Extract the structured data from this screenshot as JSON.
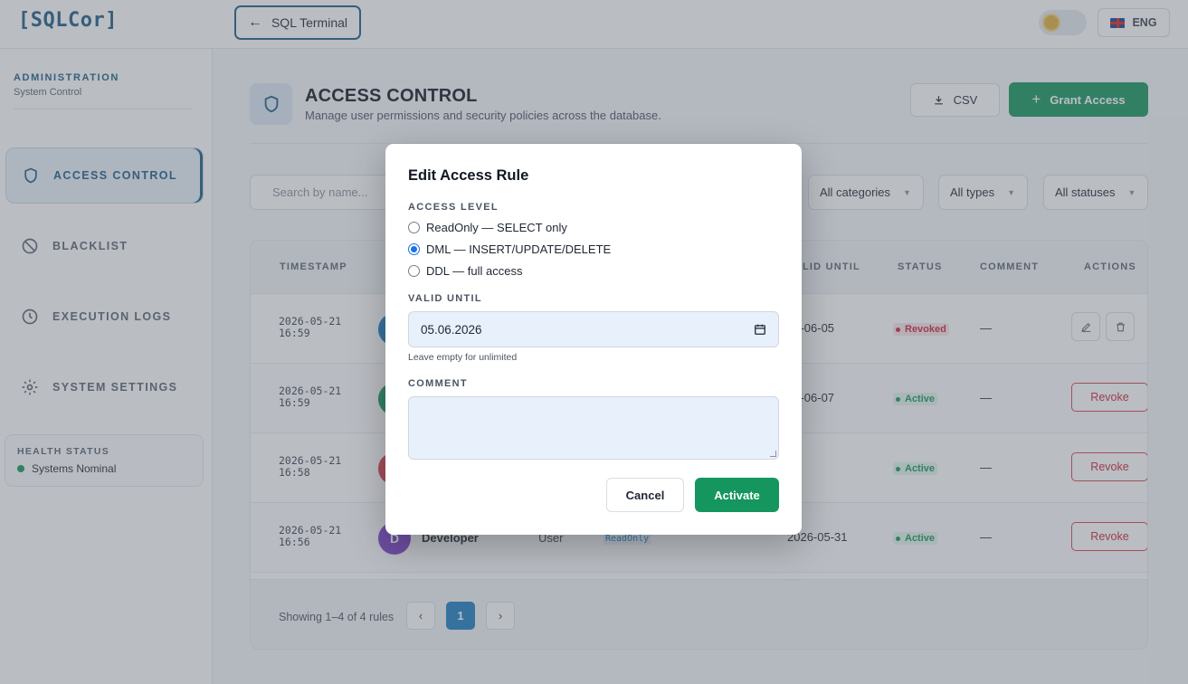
{
  "app": {
    "logo": "[SQLCor]"
  },
  "topbar": {
    "back_label": "SQL Terminal",
    "lang_label": "ENG"
  },
  "sidebar": {
    "section_title": "ADMINISTRATION",
    "section_subtitle": "System Control",
    "items": [
      {
        "label": "ACCESS CONTROL",
        "icon": "shield-icon",
        "active": true
      },
      {
        "label": "BLACKLIST",
        "icon": "ban-icon",
        "active": false
      },
      {
        "label": "EXECUTION LOGS",
        "icon": "clock-icon",
        "active": false
      },
      {
        "label": "SYSTEM SETTINGS",
        "icon": "gear-icon",
        "active": false
      }
    ],
    "health": {
      "title": "HEALTH STATUS",
      "value": "Systems Nominal",
      "color": "#15965e"
    }
  },
  "page": {
    "title": "ACCESS CONTROL",
    "subtitle": "Manage user permissions and security policies across the database.",
    "csv_label": "CSV",
    "grant_label": "Grant Access"
  },
  "filters": {
    "search_placeholder": "Search by name...",
    "categories": "All categories",
    "types": "All types",
    "statuses": "All statuses"
  },
  "table": {
    "columns": [
      "TIMESTAMP",
      "LID UNTIL",
      "STATUS",
      "COMMENT",
      "ACTIONS"
    ],
    "rows": [
      {
        "date": "2026-05-21",
        "time": "16:59",
        "avatar_color": "#1d7fbf",
        "until": "26-06-05",
        "status": "Revoked",
        "comment": "—",
        "actions": "icons"
      },
      {
        "date": "2026-05-21",
        "time": "16:59",
        "avatar_color": "#15965e",
        "until": "26-06-07",
        "status": "Active",
        "comment": "—",
        "actions": "Revoke"
      },
      {
        "date": "2026-05-21",
        "time": "16:58",
        "avatar_color": "#d9414f",
        "until": "",
        "status": "Active",
        "comment": "—",
        "actions": "Revoke"
      },
      {
        "date": "2026-05-21",
        "time": "16:56",
        "avatar_letter": "D",
        "avatar_color": "#7b3fc8",
        "name": "Developer",
        "type": "User",
        "level": "ReadOnly",
        "until": "2026-05-31",
        "status": "Active",
        "comment": "—",
        "actions": "Revoke"
      }
    ],
    "footer": {
      "showing": "Showing 1–4 of 4 rules",
      "current_page": "1"
    }
  },
  "modal": {
    "title": "Edit Access Rule",
    "access_level_label": "ACCESS LEVEL",
    "options": [
      {
        "label": "ReadOnly — SELECT only",
        "selected": false
      },
      {
        "label": "DML — INSERT/UPDATE/DELETE",
        "selected": true
      },
      {
        "label": "DDL — full access",
        "selected": false
      }
    ],
    "valid_until_label": "VALID UNTIL",
    "valid_until_value": "05.06.2026",
    "valid_until_hint": "Leave empty for unlimited",
    "comment_label": "COMMENT",
    "comment_value": "",
    "cancel_label": "Cancel",
    "activate_label": "Activate"
  },
  "colors": {
    "brand": "#1d5c86",
    "accent_green": "#15965e",
    "danger": "#c8283a",
    "link_blue": "#1d7fbf"
  }
}
